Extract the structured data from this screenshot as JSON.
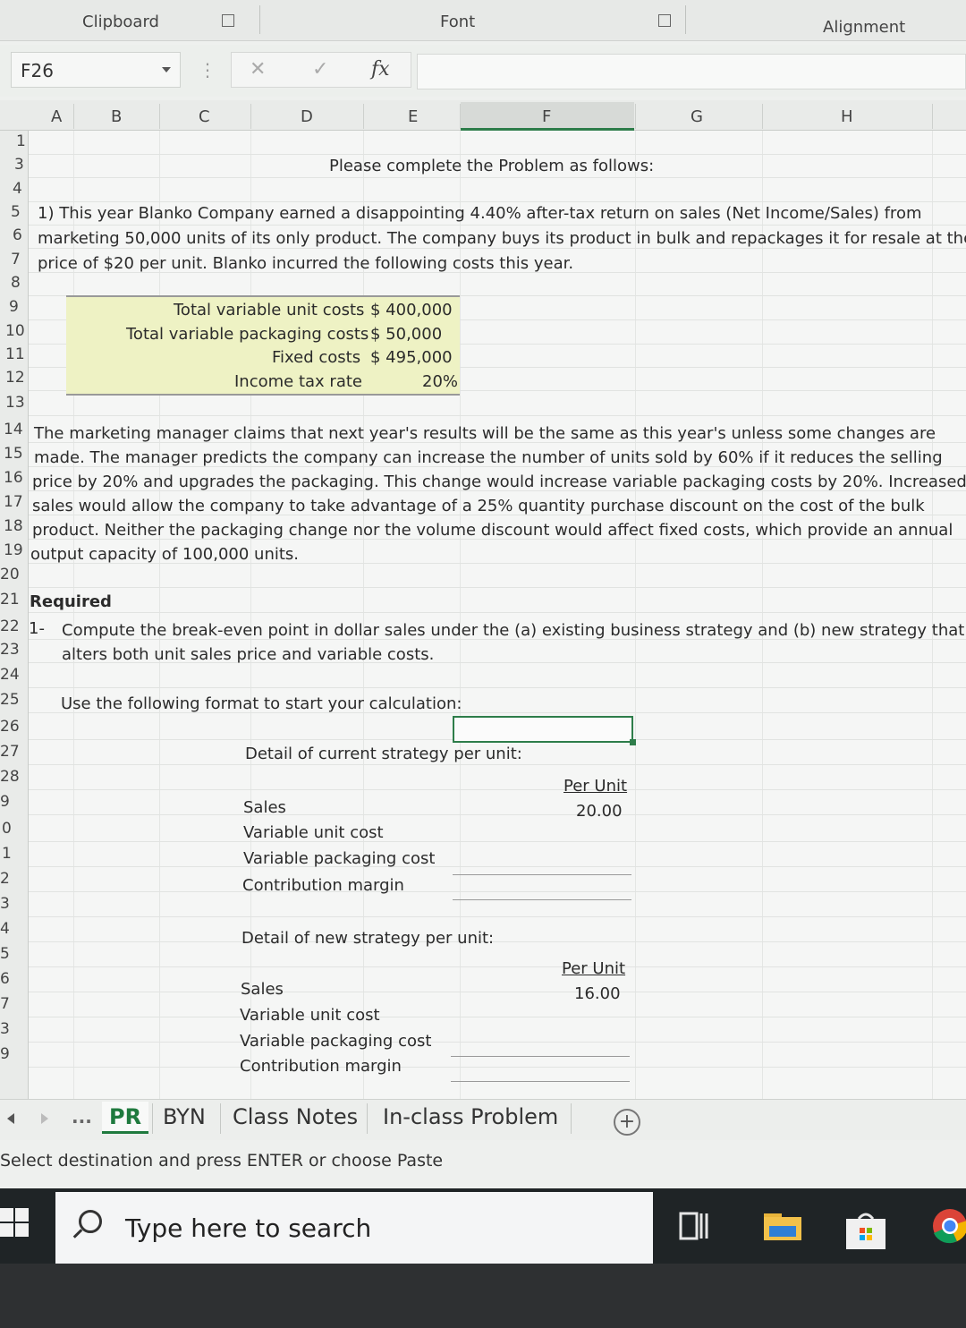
{
  "ribbon": {
    "groups": [
      "Clipboard",
      "Font",
      "Alignment"
    ]
  },
  "formula_bar": {
    "name_box": "F26",
    "fx_label": "fx",
    "cancel_glyph": "✕",
    "enter_glyph": "✓",
    "dots_glyph": "⋮",
    "formula": ""
  },
  "columns": [
    "A",
    "B",
    "C",
    "D",
    "E",
    "F",
    "G",
    "H"
  ],
  "rows": [
    "1",
    "3",
    "4",
    "5",
    "6",
    "7",
    "8",
    "9",
    "10",
    "11",
    "12",
    "13",
    "14",
    "15",
    "16",
    "17",
    "18",
    "19",
    "20",
    "21",
    "22",
    "23",
    "24",
    "25",
    "26",
    "27",
    "28",
    "9",
    "0",
    "1",
    "2",
    "3",
    "4",
    "5",
    "6",
    "7",
    "3",
    "9"
  ],
  "sheet": {
    "heading": "Please complete the Problem as follows:",
    "problem_lines": [
      "1) This year Blanko Company earned a disappointing 4.40% after-tax return on sales (Net Income/Sales) from",
      "marketing 50,000 units of its only product. The company buys its product in bulk and repackages it for resale at the",
      "price of $20 per unit. Blanko incurred the following costs this year."
    ],
    "costs": [
      {
        "label": "Total variable unit costs",
        "value": "$ 400,000"
      },
      {
        "label": "Total variable packaging costs",
        "value": "$   50,000"
      },
      {
        "label": "Fixed costs",
        "value": "$ 495,000"
      },
      {
        "label": "Income tax rate",
        "value": "20%"
      }
    ],
    "manager_lines": [
      "The marketing manager claims that next year's results will be the same as this year's unless some changes are",
      "made. The manager predicts the company can increase the number of units sold by 60% if it reduces the selling",
      "price by 20% and upgrades the packaging. This change would increase variable packaging costs by 20%. Increased",
      "sales would allow the company to take advantage of a 25% quantity purchase discount on the cost of the bulk",
      "product. Neither the packaging change nor the volume discount would affect fixed costs, which provide an annual",
      "output capacity of 100,000 units."
    ],
    "required_label": "Required",
    "req_number": "1-",
    "req_lines": [
      "Compute the break-even point in dollar sales under the (a) existing business strategy and (b) new strategy that",
      "alters both unit sales price and variable costs."
    ],
    "format_note": "Use the following format to start your calculation:",
    "current": {
      "title": "Detail of current strategy per unit:",
      "col_header": "Per Unit",
      "rows": [
        "Sales",
        "Variable unit cost",
        "Variable packaging cost",
        "Contribution margin"
      ],
      "sales_value": "20.00"
    },
    "new": {
      "title": "Detail of new strategy per unit:",
      "col_header": "Per Unit",
      "rows": [
        "Sales",
        "Variable unit cost",
        "Variable packaging cost",
        "Contribution margin"
      ],
      "sales_value": "16.00"
    }
  },
  "tabs": {
    "more": "...",
    "items": [
      "PR",
      "BYN",
      "Class Notes",
      "In-class Problem"
    ],
    "add": "+"
  },
  "status": "Select destination and press ENTER or choose Paste",
  "taskbar": {
    "search_placeholder": "Type here to search"
  },
  "colors": {
    "accent": "#1f7a3e",
    "highlight": "#eef2c4"
  }
}
